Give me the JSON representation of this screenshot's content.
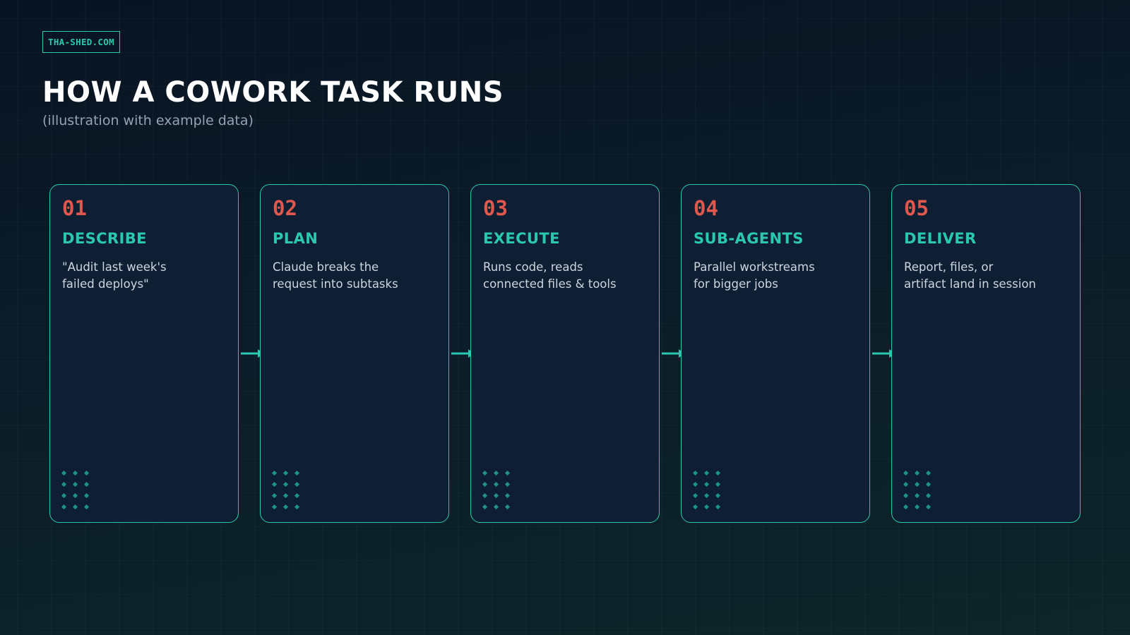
{
  "brand": {
    "label": "THA-SHED.COM"
  },
  "header": {
    "title": "HOW A COWORK TASK RUNS",
    "subtitle": "(illustration with example data)"
  },
  "colors": {
    "accent": "#2bc8b1",
    "number": "#e0574d",
    "card_background": "#0e1f33",
    "page_background": "#0a1a26"
  },
  "steps": [
    {
      "number": "01",
      "title": "DESCRIBE",
      "description": "\"Audit last week's\nfailed deploys\""
    },
    {
      "number": "02",
      "title": "PLAN",
      "description": "Claude breaks the\nrequest into subtasks"
    },
    {
      "number": "03",
      "title": "EXECUTE",
      "description": "Runs code, reads\nconnected files & tools"
    },
    {
      "number": "04",
      "title": "SUB-AGENTS",
      "description": "Parallel workstreams\nfor bigger jobs"
    },
    {
      "number": "05",
      "title": "DELIVER",
      "description": "Report, files, or\nartifact land in session"
    }
  ]
}
